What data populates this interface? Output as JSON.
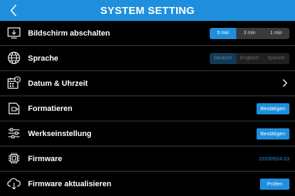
{
  "header": {
    "title": "SYSTEM SETTING"
  },
  "rows": {
    "screen_off": {
      "label": "Bildschirm abschalten",
      "options": [
        "5 min",
        "3 min",
        "1 min"
      ],
      "selected": "5 min"
    },
    "language": {
      "label": "Sprache",
      "options": [
        "Deutsch",
        "Englisch",
        "Spanish"
      ],
      "selected": "Deutsch"
    },
    "datetime": {
      "label": "Datum & Uhrzeit"
    },
    "format": {
      "label": "Formatieren",
      "button": "Bestätigen"
    },
    "factory_reset": {
      "label": "Werkseinstellung",
      "button": "Bestätigen"
    },
    "firmware": {
      "label": "Firmware",
      "value": "20200924.03"
    },
    "firmware_update": {
      "label": "Firmware aktualisieren",
      "button": "Prüfen"
    }
  },
  "colors": {
    "accent": "#1f8fdd",
    "background": "#000000",
    "divider": "#3a3a3a"
  },
  "icons": [
    "chevron-left-icon",
    "display-off-icon",
    "globe-icon",
    "calendar-clock-icon",
    "sd-card-icon",
    "sliders-icon",
    "chip-icon",
    "cloud-download-icon",
    "chevron-right-icon"
  ]
}
